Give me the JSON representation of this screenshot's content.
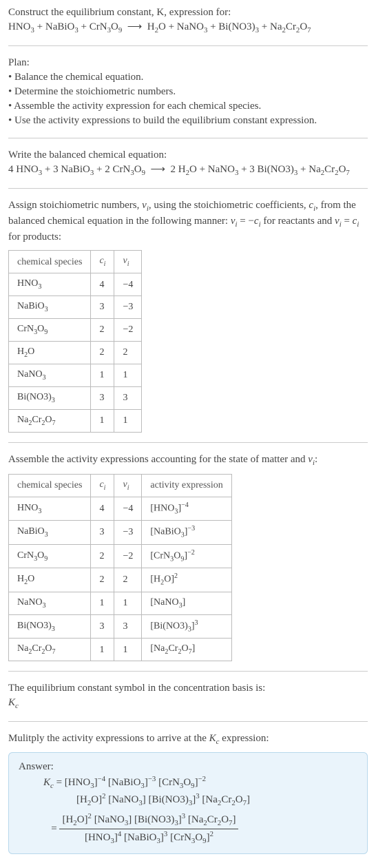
{
  "title_line1": "Construct the equilibrium constant, K, expression for:",
  "unbalanced_eq": "HNO₃ + NaBiO₃ + CrN₃O₉ ⟶ H₂O + NaNO₃ + Bi(NO3)₃ + Na₂Cr₂O₇",
  "plan_heading": "Plan:",
  "plan_items": [
    "• Balance the chemical equation.",
    "• Determine the stoichiometric numbers.",
    "• Assemble the activity expression for each chemical species.",
    "• Use the activity expressions to build the equilibrium constant expression."
  ],
  "balanced_heading": "Write the balanced chemical equation:",
  "balanced_eq": "4 HNO₃ + 3 NaBiO₃ + 2 CrN₃O₉ ⟶ 2 H₂O + NaNO₃ + 3 Bi(NO3)₃ + Na₂Cr₂O₇",
  "assign_text": "Assign stoichiometric numbers, νᵢ, using the stoichiometric coefficients, cᵢ, from the balanced chemical equation in the following manner: νᵢ = −cᵢ for reactants and νᵢ = cᵢ for products:",
  "table1_headers": [
    "chemical species",
    "cᵢ",
    "νᵢ"
  ],
  "table1_rows": [
    {
      "species": "HNO₃",
      "c": "4",
      "v": "−4"
    },
    {
      "species": "NaBiO₃",
      "c": "3",
      "v": "−3"
    },
    {
      "species": "CrN₃O₉",
      "c": "2",
      "v": "−2"
    },
    {
      "species": "H₂O",
      "c": "2",
      "v": "2"
    },
    {
      "species": "NaNO₃",
      "c": "1",
      "v": "1"
    },
    {
      "species": "Bi(NO3)₃",
      "c": "3",
      "v": "3"
    },
    {
      "species": "Na₂Cr₂O₇",
      "c": "1",
      "v": "1"
    }
  ],
  "assemble_text": "Assemble the activity expressions accounting for the state of matter and νᵢ:",
  "table2_headers": [
    "chemical species",
    "cᵢ",
    "νᵢ",
    "activity expression"
  ],
  "table2_rows": [
    {
      "species": "HNO₃",
      "c": "4",
      "v": "−4",
      "act": "[HNO₃]⁻⁴"
    },
    {
      "species": "NaBiO₃",
      "c": "3",
      "v": "−3",
      "act": "[NaBiO₃]⁻³"
    },
    {
      "species": "CrN₃O₉",
      "c": "2",
      "v": "−2",
      "act": "[CrN₃O₉]⁻²"
    },
    {
      "species": "H₂O",
      "c": "2",
      "v": "2",
      "act": "[H₂O]²"
    },
    {
      "species": "NaNO₃",
      "c": "1",
      "v": "1",
      "act": "[NaNO₃]"
    },
    {
      "species": "Bi(NO3)₃",
      "c": "3",
      "v": "3",
      "act": "[Bi(NO3)₃]³"
    },
    {
      "species": "Na₂Cr₂O₇",
      "c": "1",
      "v": "1",
      "act": "[Na₂Cr₂O₇]"
    }
  ],
  "kc_basis_line1": "The equilibrium constant symbol in the concentration basis is:",
  "kc_basis_line2": "K_c",
  "multiply_text": "Mulitply the activity expressions to arrive at the K_c expression:",
  "answer_label": "Answer:",
  "kc_line1": "K_c = [HNO₃]⁻⁴ [NaBiO₃]⁻³ [CrN₃O₉]⁻²",
  "kc_line2": "[H₂O]² [NaNO₃] [Bi(NO3)₃]³ [Na₂Cr₂O₇]",
  "kc_frac_num": "[H₂O]² [NaNO₃] [Bi(NO3)₃]³ [Na₂Cr₂O₇]",
  "kc_frac_den": "[HNO₃]⁴ [NaBiO₃]³ [CrN₃O₉]²"
}
